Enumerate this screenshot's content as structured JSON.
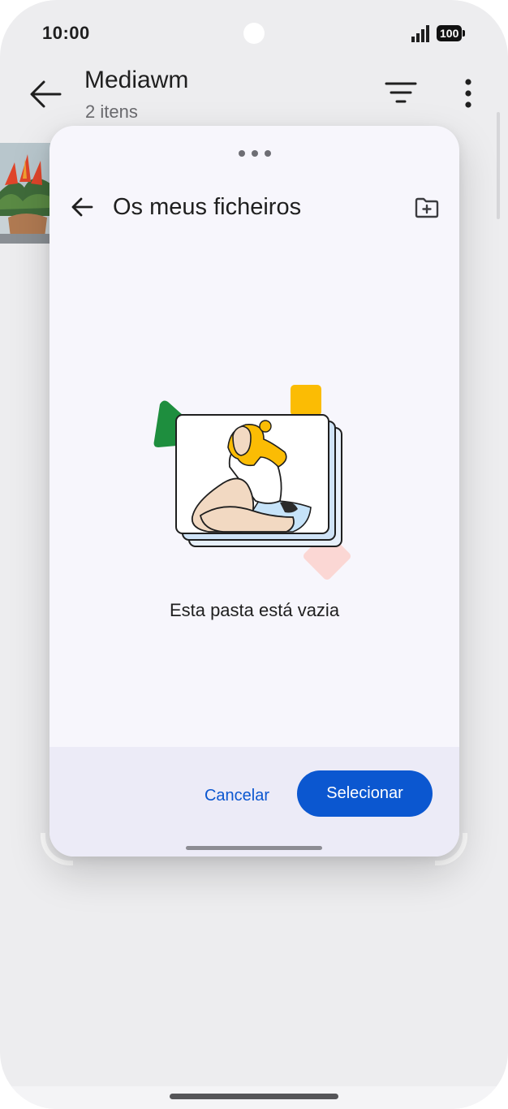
{
  "status_bar": {
    "time": "10:00",
    "battery": "100"
  },
  "app_header": {
    "title": "Mediawm",
    "subtitle": "2 itens",
    "back_icon": "arrow-left-icon",
    "filter_icon": "filter-icon",
    "more_icon": "more-vert-icon"
  },
  "picker": {
    "title": "Os meus ficheiros",
    "back_icon": "arrow-left-icon",
    "new_folder_icon": "create-new-folder-icon",
    "empty_message": "Esta pasta está vazia",
    "cancel_label": "Cancelar",
    "select_label": "Selecionar"
  },
  "colors": {
    "accent": "#0b57d0",
    "sheet_background": "#f7f6fc",
    "footer_background": "#ecebf7",
    "page_background": "#ededef"
  }
}
